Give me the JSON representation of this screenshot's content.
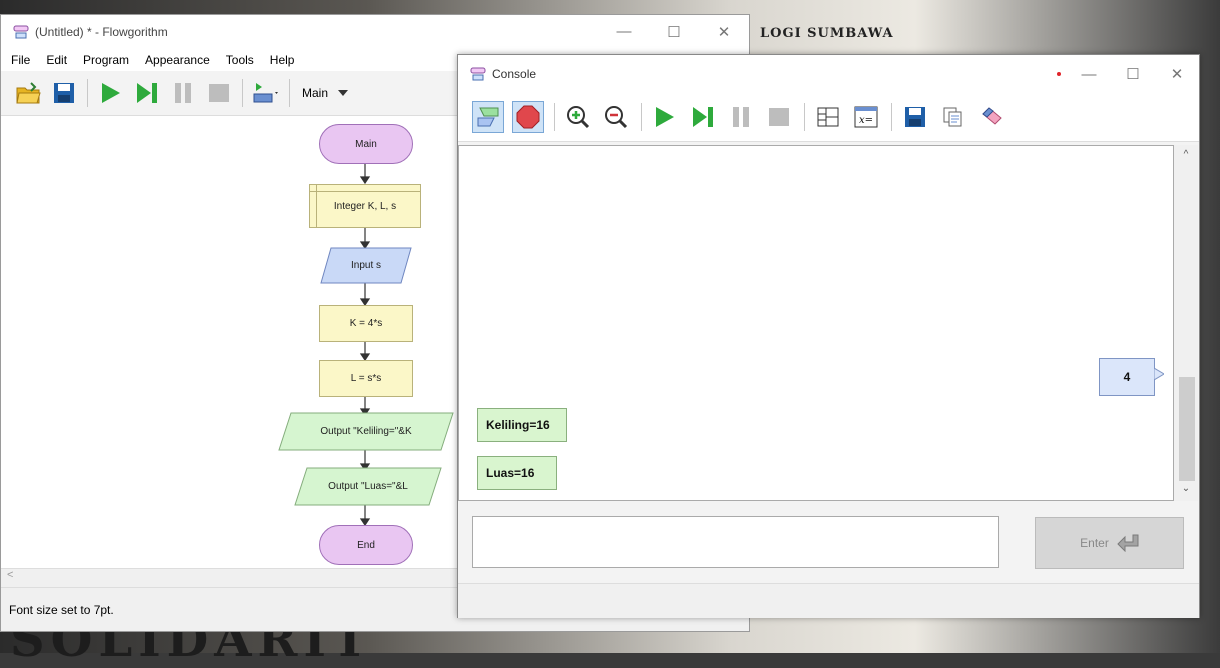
{
  "background": {
    "top_text": "…",
    "sub_text": "LOGI SUMBAWA",
    "bottom_text": "SOLIDARIT"
  },
  "main_window": {
    "title": "(Untitled) * - Flowgorithm",
    "controls": {
      "minimize": "—",
      "maximize": "☐",
      "close": "✕"
    },
    "menu": [
      "File",
      "Edit",
      "Program",
      "Appearance",
      "Tools",
      "Help"
    ],
    "function_select": "Main",
    "status": "Font size set to 7pt.",
    "scroll_left": "<"
  },
  "flowchart": {
    "start": "Main",
    "declare": "Integer K, L, s",
    "input": "Input s",
    "assign1": "K = 4*s",
    "assign2": "L = s*s",
    "output1": "Output \"Keliling=\"&K",
    "output2": "Output \"Luas=\"&L",
    "end": "End"
  },
  "console": {
    "title": "Console",
    "controls": {
      "minimize": "—",
      "maximize": "☐",
      "close": "✕"
    },
    "input_echo": "4",
    "outputs": [
      "Keliling=16",
      "Luas=16"
    ],
    "enter_label": "Enter",
    "scroll_up": "^",
    "scroll_down": "⌄"
  },
  "colors": {
    "run_green": "#2eaa3c",
    "save_blue": "#1f5fa8",
    "terminal_fill": "#e9c6f2",
    "process_fill": "#fbf7c8",
    "io_fill": "#c9d9f7",
    "output_fill": "#d6f5d0"
  }
}
